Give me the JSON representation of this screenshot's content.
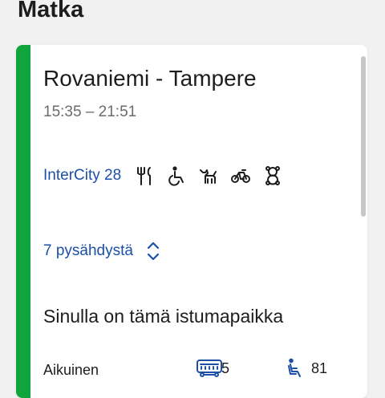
{
  "page": {
    "title": "Matka"
  },
  "journey": {
    "route": "Rovaniemi - Tampere",
    "time": "15:35 – 21:51",
    "accent_color": "#11a33c",
    "train": {
      "name": "InterCity 28",
      "services": [
        "restaurant-icon",
        "wheelchair-icon",
        "pet-icon",
        "bicycle-icon",
        "teddy-bear-icon"
      ]
    },
    "stops": {
      "label": "7 pysähdystä",
      "toggle_icon": "expand-collapse-icon"
    },
    "seat_section": {
      "heading": "Sinulla on tämä istumapaikka",
      "passenger_type": "Aikuinen",
      "wagon": "5",
      "seat": "81",
      "wagon_icon": "train-wagon-icon",
      "seat_icon": "seat-icon"
    }
  },
  "colors": {
    "link": "#1b4fa8",
    "text": "#1d1d1d",
    "muted": "#6b6b6b"
  }
}
